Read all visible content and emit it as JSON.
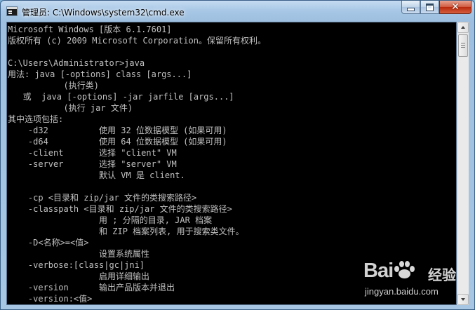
{
  "window": {
    "title": "管理员: C:\\Windows\\system32\\cmd.exe",
    "icon": "cmd-console-icon",
    "controls": {
      "minimize": "minimize-icon",
      "maximize": "maximize-icon",
      "close": "close-icon"
    }
  },
  "console": {
    "lines": [
      "Microsoft Windows [版本 6.1.7601]",
      "版权所有 (c) 2009 Microsoft Corporation。保留所有权利。",
      "",
      "C:\\Users\\Administrator>java",
      "用法: java [-options] class [args...]",
      "           (执行类)",
      "   或  java [-options] -jar jarfile [args...]",
      "           (执行 jar 文件)",
      "其中选项包括:",
      "    -d32          使用 32 位数据模型 (如果可用)",
      "    -d64          使用 64 位数据模型 (如果可用)",
      "    -client       选择 \"client\" VM",
      "    -server       选择 \"server\" VM",
      "                  默认 VM 是 client.",
      "",
      "    -cp <目录和 zip/jar 文件的类搜索路径>",
      "    -classpath <目录和 zip/jar 文件的类搜索路径>",
      "                  用 ; 分隔的目录, JAR 档案",
      "                  和 ZIP 档案列表, 用于搜索类文件。",
      "    -D<名称>=<值>",
      "                  设置系统属性",
      "    -verbose:[class|gc|jni]",
      "                  启用详细输出",
      "    -version      输出产品版本并退出",
      "    -version:<值>"
    ],
    "colors": {
      "background": "#000000",
      "text": "#c0c0c0"
    }
  },
  "scrollbar": {
    "up": "scroll-up-arrow-icon",
    "down": "scroll-down-arrow-icon",
    "thumb_position": 0.0
  },
  "watermark": {
    "logo_text_left": "Bai",
    "logo_text_cn": "经验",
    "url": "jingyan.baidu.com"
  }
}
